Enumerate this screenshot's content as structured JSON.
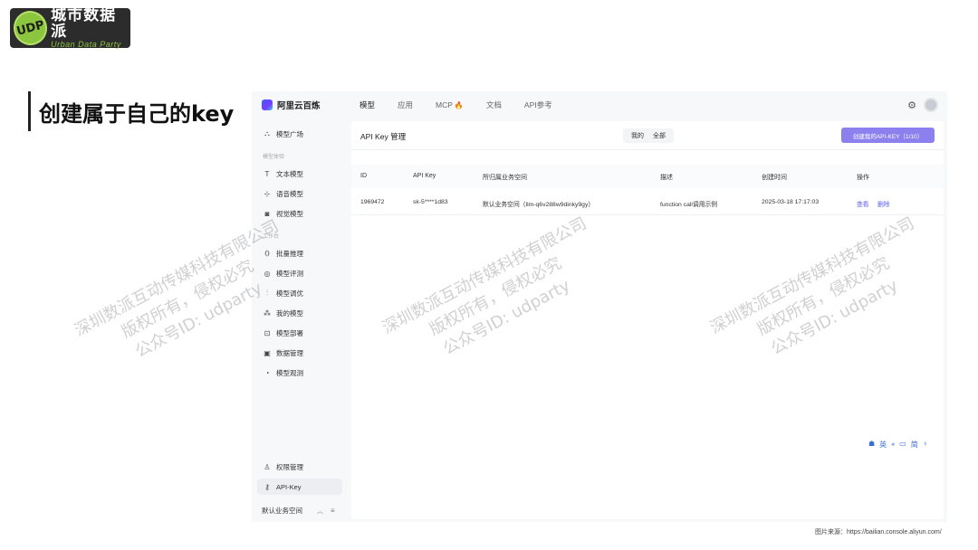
{
  "slide": {
    "logo": {
      "badge": "UDP",
      "name_cn": "城市数据派",
      "name_en": "Urban Data Party"
    },
    "title": "创建属于自己的key",
    "source_note": "图片来源：https://bailian.console.aliyun.com/"
  },
  "app": {
    "brand": "阿里云百炼",
    "nav": [
      {
        "label": "模型",
        "active": true
      },
      {
        "label": "应用",
        "active": false
      },
      {
        "label": "MCP",
        "active": false,
        "badge_icon": "fire-icon"
      },
      {
        "label": "文档",
        "active": false
      },
      {
        "label": "API参考",
        "active": false
      }
    ],
    "sidebar": {
      "top_item": {
        "label": "模型广场",
        "icon": "plaza-icon"
      },
      "group1": "模型体验",
      "group1_items": [
        {
          "label": "文本模型",
          "icon": "text-icon"
        },
        {
          "label": "语音模型",
          "icon": "voice-icon"
        },
        {
          "label": "视觉模型",
          "icon": "camera-icon"
        }
      ],
      "group2": "工作台",
      "group2_items": [
        {
          "label": "批量推理",
          "icon": "batch-icon"
        },
        {
          "label": "模型评测",
          "icon": "eval-icon"
        },
        {
          "label": "模型调优",
          "icon": "tune-icon"
        },
        {
          "label": "我的模型",
          "icon": "models-icon"
        },
        {
          "label": "模型部署",
          "icon": "deploy-icon"
        },
        {
          "label": "数据管理",
          "icon": "data-icon"
        },
        {
          "label": "模型观测",
          "icon": "observe-icon"
        }
      ],
      "bottom_items": [
        {
          "label": "权限管理",
          "icon": "user-icon"
        },
        {
          "label": "API-Key",
          "icon": "key-icon",
          "active": true
        }
      ],
      "workspace": "默认业务空间"
    },
    "panel": {
      "title": "API Key 管理",
      "filter": {
        "mine": "我的",
        "all": "全部"
      },
      "create_button": "创建我的API-KEY（1/10）",
      "columns": [
        "ID",
        "API Key",
        "所归属业务空间",
        "描述",
        "创建时间",
        "操作"
      ],
      "rows": [
        {
          "id": "1969472",
          "key": "sk-5****1d83",
          "workspace": "默认业务空间（llm-q6v288w9dinky9gy）",
          "desc": "function call调用示例",
          "created": "2025-03-18 17:17:03",
          "actions": {
            "view": "查看",
            "delete": "删除"
          }
        }
      ]
    },
    "ime_toolbar": [
      "英",
      "⁎",
      "▭",
      "简",
      "♀"
    ]
  },
  "watermark": {
    "line1": "深圳数派互动传媒科技有限公司",
    "line2": "版权所有，侵权必究",
    "line3": "公众号ID: udparty"
  },
  "colors": {
    "accent": "#8b80ee",
    "link": "#5b5ef0",
    "logo_green": "#8cc63f"
  }
}
